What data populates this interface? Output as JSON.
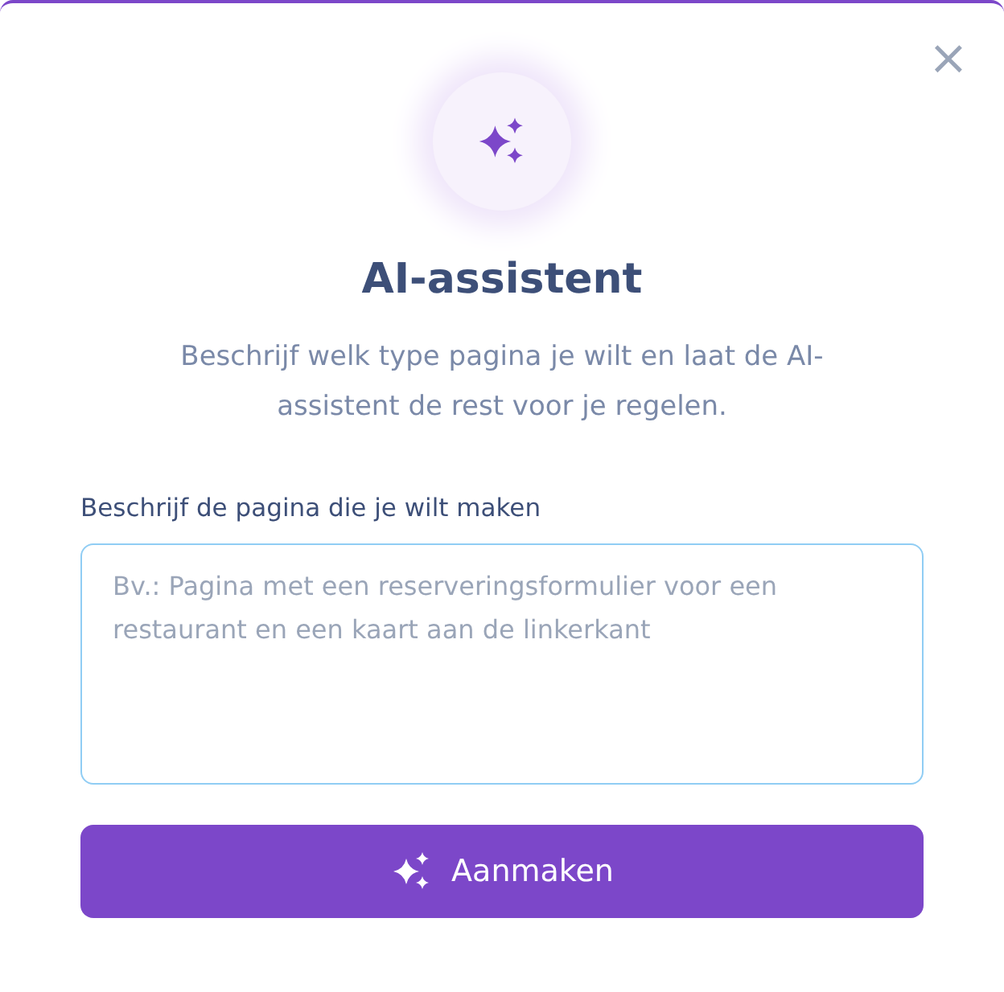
{
  "dialog": {
    "title": "AI-assistent",
    "description": "Beschrijf welk type pagina je wilt en laat de AI-assistent de rest voor je regelen.",
    "close": "×"
  },
  "field": {
    "label": "Beschrijf de pagina die je wilt maken",
    "placeholder": "Bv.: Pagina met een reserveringsformulier voor een restaurant en een kaart aan de linkerkant"
  },
  "buttons": [
    {
      "label": "Aanmaken"
    }
  ]
}
